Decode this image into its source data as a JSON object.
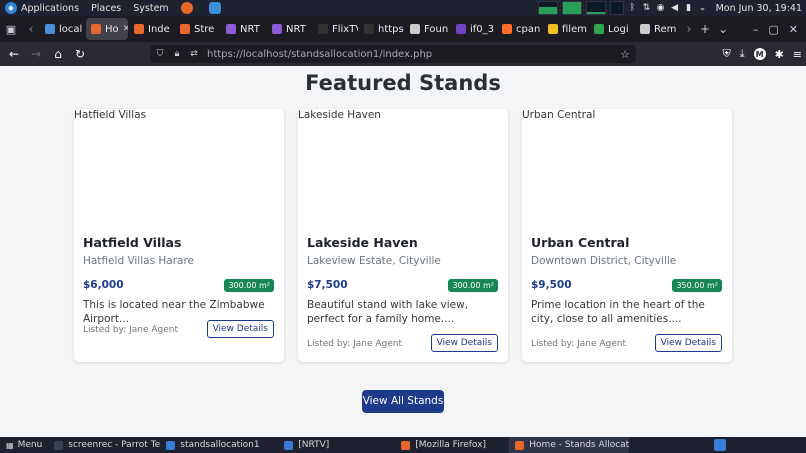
{
  "os_panel": {
    "menus": [
      "Applications",
      "Places",
      "System"
    ],
    "clock": "Mon Jun 30, 19:41"
  },
  "browser": {
    "tabs": [
      {
        "label": "local",
        "favicon_color": "#4a90d9"
      },
      {
        "label": "Ho",
        "favicon_color": "#e8672b",
        "active": true
      },
      {
        "label": "Inde",
        "favicon_color": "#e8672b"
      },
      {
        "label": "Stre",
        "favicon_color": "#e8672b"
      },
      {
        "label": "NRT",
        "favicon_color": "#8a5cd6"
      },
      {
        "label": "NRT",
        "favicon_color": "#8a5cd6"
      },
      {
        "label": "FlixTV -",
        "favicon_color": "#333333"
      },
      {
        "label": "https://l",
        "favicon_color": "#333333"
      },
      {
        "label": "Foun",
        "favicon_color": "#cccccc"
      },
      {
        "label": "if0_3",
        "favicon_color": "#6f42c1"
      },
      {
        "label": "cpan",
        "favicon_color": "#ff6c2c"
      },
      {
        "label": "filem",
        "favicon_color": "#f0c020"
      },
      {
        "label": "Logi",
        "favicon_color": "#2ea44f"
      },
      {
        "label": "Rem",
        "favicon_color": "#cccccc"
      }
    ],
    "url": "https://localhost/standsallocation1/index.php",
    "profile_initial": "M"
  },
  "page": {
    "section_title": "Featured Stands",
    "view_all_label": "View All Stands",
    "stands": [
      {
        "image_alt": "Hatfield Villas",
        "name": "Hatfield Villas",
        "location": "Hatfield Villas Harare",
        "price": "$6,000",
        "size": "300.00 m²",
        "description": "This is located near the Zimbabwe Airport...",
        "listed_by": "Listed by: Jane Agent",
        "button": "View Details"
      },
      {
        "image_alt": "Lakeside Haven",
        "name": "Lakeside Haven",
        "location": "Lakeview Estate, Cityville",
        "price": "$7,500",
        "size": "300.00 m²",
        "description": "Beautiful stand with lake view, perfect for a family home....",
        "listed_by": "Listed by: Jane Agent",
        "button": "View Details"
      },
      {
        "image_alt": "Urban Central",
        "name": "Urban Central",
        "location": "Downtown District, Cityville",
        "price": "$9,500",
        "size": "350.00 m²",
        "description": "Prime location in the heart of the city, close to all amenities....",
        "listed_by": "Listed by: Jane Agent",
        "button": "View Details"
      }
    ]
  },
  "taskbar": {
    "menu_label": "Menu",
    "tasks": [
      {
        "label": "screenrec - Parrot Ter...",
        "icon_color": "#3b4252"
      },
      {
        "label": "standsallocation1",
        "icon_color": "#3a7bd5"
      },
      {
        "label": "[NRTV]",
        "icon_color": "#3a7bd5"
      },
      {
        "label": "[Mozilla Firefox]",
        "icon_color": "#e8672b"
      },
      {
        "label": "Home - Stands Allocati...",
        "icon_color": "#e8672b",
        "active": true
      }
    ]
  }
}
